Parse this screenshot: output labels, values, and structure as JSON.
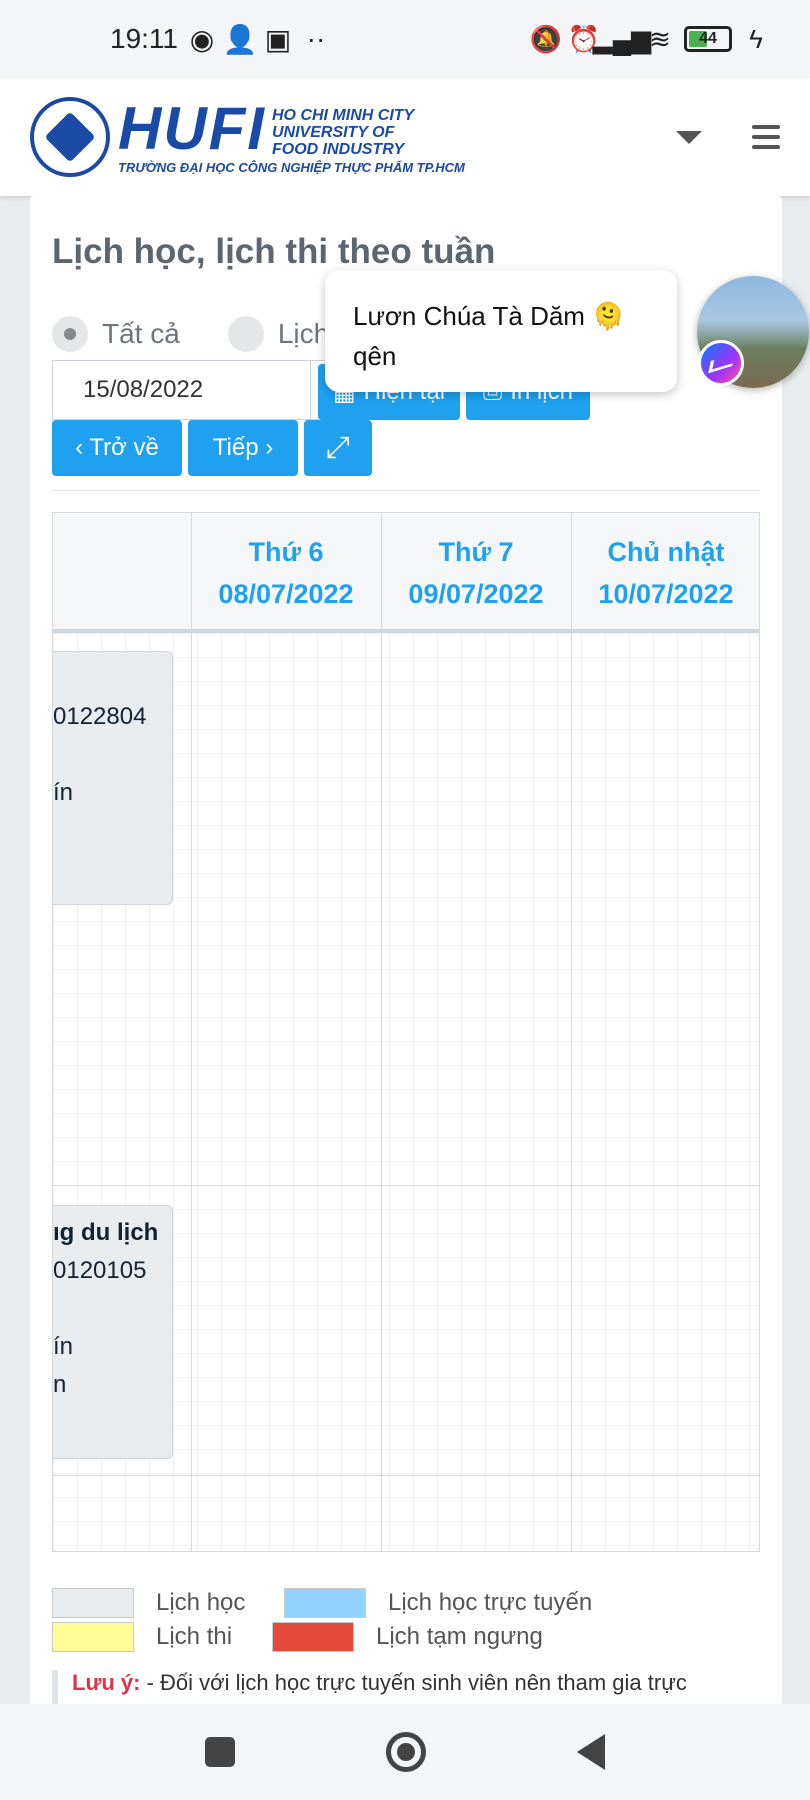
{
  "status_bar": {
    "time": "19:11",
    "battery": "44"
  },
  "header": {
    "logo_main": "HUFI",
    "logo_line1": "HO CHI MINH CITY",
    "logo_line2": "UNIVERSITY OF",
    "logo_line3": "FOOD INDUSTRY",
    "logo_sub": "TRƯỜNG ĐẠI HỌC CÔNG NGHIỆP THỰC PHẨM TP.HCM"
  },
  "page": {
    "title": "Lịch học, lịch thi theo tuần",
    "radio_all": "Tất cả",
    "radio_study": "Lịch",
    "date_value": "15/08/2022",
    "btn_current": "Hiện tại",
    "btn_print": "In lịch",
    "btn_back": "‹ Trở về",
    "btn_next": "Tiếp ›",
    "btn_expand": "⤢"
  },
  "schedule": {
    "days": [
      {
        "name": "Thứ 6",
        "date": "08/07/2022"
      },
      {
        "name": "Thứ 7",
        "date": "09/07/2022"
      },
      {
        "name": "Chủ nhật",
        "date": "10/07/2022"
      }
    ],
    "events": [
      {
        "line1": "",
        "line2": "0122804",
        "line3": "",
        "line4": "ín"
      },
      {
        "line1": "ıg du lịch",
        "line2": "0120105",
        "line3": "",
        "line4": "ín",
        "line5": "n"
      }
    ]
  },
  "legend": {
    "study": "Lịch học",
    "online": "Lịch học trực tuyến",
    "exam": "Lịch thi",
    "suspended": "Lịch tạm ngưng",
    "colors": {
      "study": "#e9ecef",
      "online": "#8fd3fe",
      "exam": "#fffd95",
      "suspended": "#e34a3a"
    }
  },
  "note": {
    "label": "Lưu ý:",
    "text": "- Đối với lịch học trực tuyến sinh viên nên tham gia trực"
  },
  "chat_bubble": {
    "line1": "Lươn Chúa Tà Dăm 🫠",
    "line2": "qên"
  }
}
